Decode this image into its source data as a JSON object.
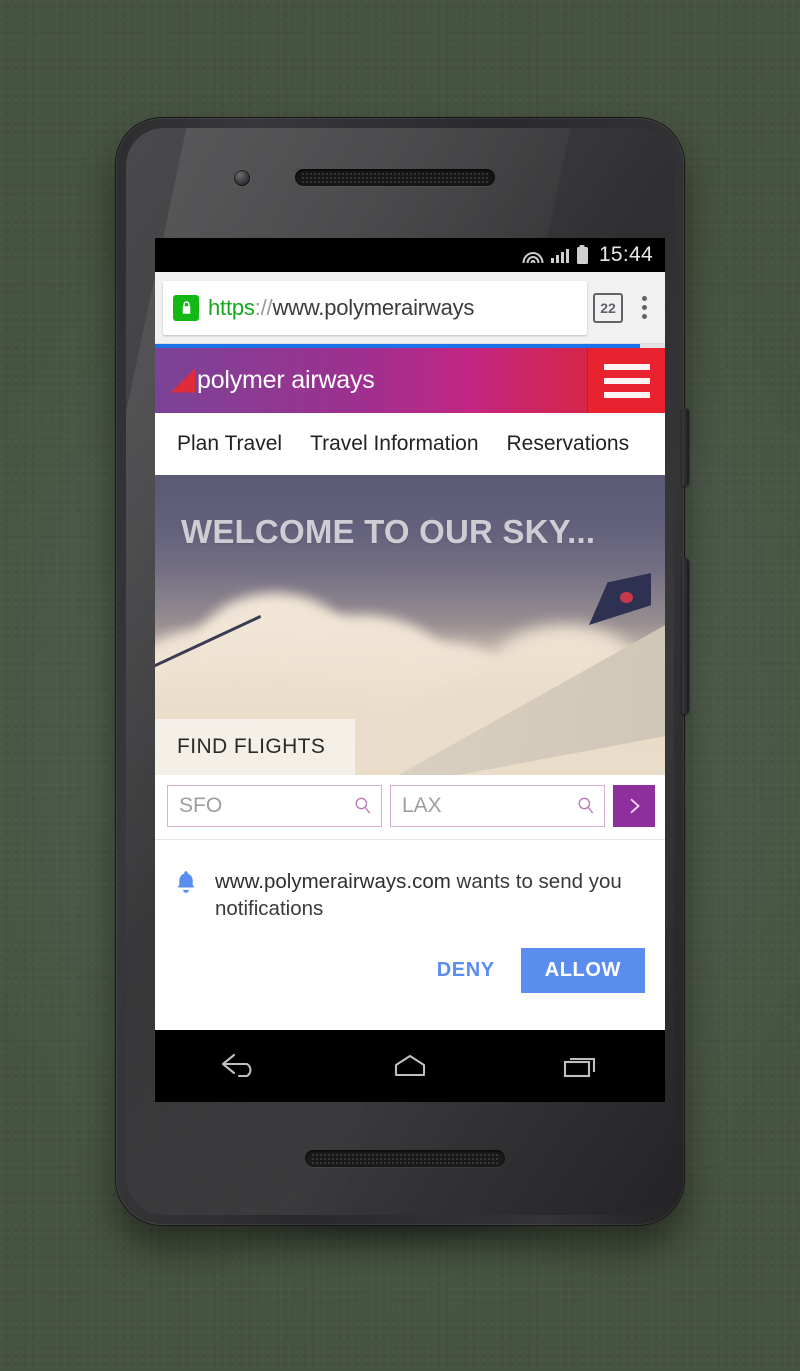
{
  "device": {
    "label": "android-phone-mockup",
    "front_camera": "camera-icon",
    "earpiece": "speaker-grille",
    "bottom_speaker": "speaker-grille",
    "power_button": "power-button",
    "volume_button": "volume-rocker"
  },
  "status_bar": {
    "time": "15:44",
    "wifi_icon": "wifi-icon",
    "signal_icon": "cellular-signal-icon",
    "battery_icon": "battery-icon"
  },
  "browser": {
    "lock_icon": "lock-icon",
    "url_scheme": "https",
    "url_separator": "://",
    "url_host": "www.polymerairways",
    "url_full": "https://www.polymerairways",
    "tab_count": "22",
    "overflow_icon": "overflow-menu-icon",
    "progress_percent": 95
  },
  "site": {
    "brand_name": "polymer airways",
    "brand_logo_icon": "airplane-tail-logo-icon",
    "menu_icon": "hamburger-menu-icon",
    "header_gradient_start": "#7b4397",
    "header_gradient_end": "#e0212c",
    "menu_button_color": "#e8222e",
    "nav": [
      {
        "label": "Plan Travel"
      },
      {
        "label": "Travel Information"
      },
      {
        "label": "Reservations"
      }
    ],
    "hero": {
      "title": "WELCOME TO OUR SKY...",
      "tab_label": "FIND FLIGHTS"
    },
    "search": {
      "origin_value": "SFO",
      "origin_placeholder": "SFO",
      "destination_value": "LAX",
      "destination_placeholder": "LAX",
      "origin_search_icon": "search-icon",
      "destination_search_icon": "search-icon",
      "go_icon": "chevron-right-icon",
      "go_button_color": "#8e2f9e"
    }
  },
  "notification_dialog": {
    "bell_icon": "bell-icon",
    "origin": "www.polymerairways.com",
    "message": " wants to send you notifications",
    "full_message": "www.polymerairways.com wants to send you notifications",
    "deny_label": "DENY",
    "allow_label": "ALLOW",
    "accent_color": "#5b8def"
  },
  "nav_bar": {
    "back_icon": "back-arrow-icon",
    "home_icon": "home-icon",
    "recents_icon": "recent-apps-icon"
  }
}
